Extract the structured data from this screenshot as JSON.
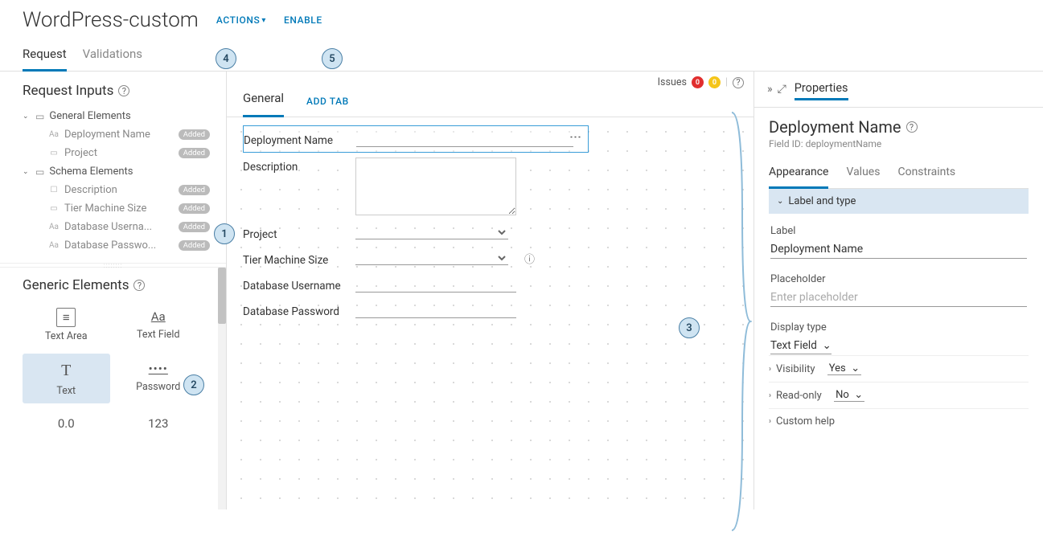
{
  "header": {
    "title": "WordPress-custom",
    "actions_label": "ACTIONS",
    "enable_label": "ENABLE"
  },
  "tabs": {
    "request": "Request",
    "validations": "Validations"
  },
  "request_inputs": {
    "heading": "Request Inputs",
    "folders": [
      {
        "label": "General Elements",
        "items": [
          {
            "icon": "text-icon",
            "label": "Deployment Name",
            "badge": "Added"
          },
          {
            "icon": "select-icon",
            "label": "Project",
            "badge": "Added"
          }
        ]
      },
      {
        "label": "Schema Elements",
        "items": [
          {
            "icon": "checkbox-icon",
            "label": "Description",
            "badge": "Added"
          },
          {
            "icon": "select-icon",
            "label": "Tier Machine Size",
            "badge": "Added"
          },
          {
            "icon": "text-icon",
            "label": "Database Userna...",
            "badge": "Added"
          },
          {
            "icon": "text-icon",
            "label": "Database Passwo...",
            "badge": "Added"
          }
        ]
      }
    ]
  },
  "generic_elements": {
    "heading": "Generic Elements",
    "items": [
      {
        "icon": "≡",
        "label": "Text Area"
      },
      {
        "icon": "Aa",
        "label": "Text Field"
      },
      {
        "icon": "T",
        "label": "Text"
      },
      {
        "icon": "••••",
        "label": "Password"
      },
      {
        "icon": "0.0",
        "label": ""
      },
      {
        "icon": "123",
        "label": ""
      }
    ]
  },
  "canvas": {
    "issues_label": "Issues",
    "issues_err": "0",
    "issues_warn": "0",
    "tab_general": "General",
    "add_tab": "ADD TAB",
    "fields": {
      "deployment_name": "Deployment Name",
      "description": "Description",
      "project": "Project",
      "tier_machine_size": "Tier Machine Size",
      "db_user": "Database Username",
      "db_pass": "Database Password"
    }
  },
  "props": {
    "panel_title": "Properties",
    "heading": "Deployment Name",
    "field_id": "Field ID: deploymentName",
    "tabs": {
      "appearance": "Appearance",
      "values": "Values",
      "constraints": "Constraints"
    },
    "acc_label_type": "Label and type",
    "label_label": "Label",
    "label_value": "Deployment Name",
    "placeholder_label": "Placeholder",
    "placeholder_ph": "Enter placeholder",
    "display_type_label": "Display type",
    "display_type_value": "Text Field",
    "visibility_label": "Visibility",
    "visibility_value": "Yes",
    "readonly_label": "Read-only",
    "readonly_value": "No",
    "custom_help": "Custom help"
  },
  "callouts": {
    "c1": "1",
    "c2": "2",
    "c3": "3",
    "c4": "4",
    "c5": "5"
  }
}
